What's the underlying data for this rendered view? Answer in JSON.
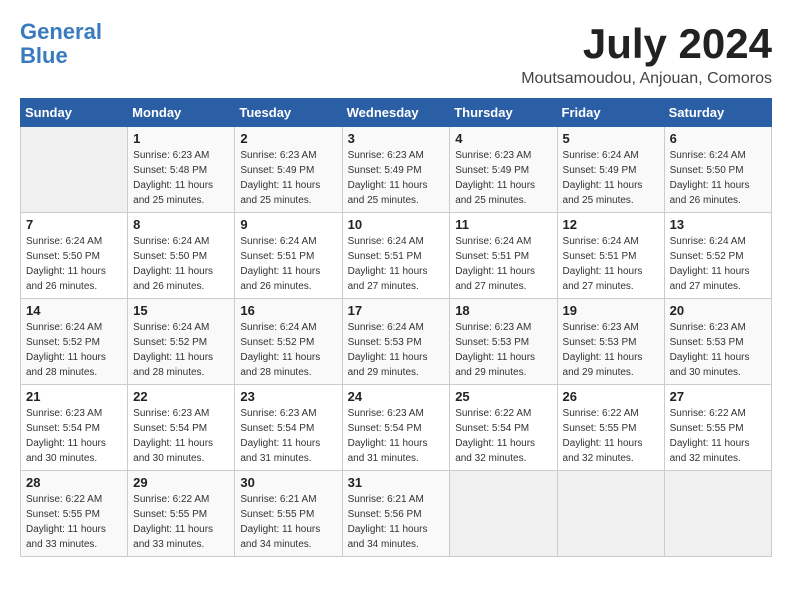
{
  "header": {
    "logo_line1": "General",
    "logo_line2": "Blue",
    "month_title": "July 2024",
    "location": "Moutsamoudou, Anjouan, Comoros"
  },
  "days_of_week": [
    "Sunday",
    "Monday",
    "Tuesday",
    "Wednesday",
    "Thursday",
    "Friday",
    "Saturday"
  ],
  "weeks": [
    [
      {
        "day": "",
        "sunrise": "",
        "sunset": "",
        "daylight": ""
      },
      {
        "day": "1",
        "sunrise": "Sunrise: 6:23 AM",
        "sunset": "Sunset: 5:48 PM",
        "daylight": "Daylight: 11 hours and 25 minutes."
      },
      {
        "day": "2",
        "sunrise": "Sunrise: 6:23 AM",
        "sunset": "Sunset: 5:49 PM",
        "daylight": "Daylight: 11 hours and 25 minutes."
      },
      {
        "day": "3",
        "sunrise": "Sunrise: 6:23 AM",
        "sunset": "Sunset: 5:49 PM",
        "daylight": "Daylight: 11 hours and 25 minutes."
      },
      {
        "day": "4",
        "sunrise": "Sunrise: 6:23 AM",
        "sunset": "Sunset: 5:49 PM",
        "daylight": "Daylight: 11 hours and 25 minutes."
      },
      {
        "day": "5",
        "sunrise": "Sunrise: 6:24 AM",
        "sunset": "Sunset: 5:49 PM",
        "daylight": "Daylight: 11 hours and 25 minutes."
      },
      {
        "day": "6",
        "sunrise": "Sunrise: 6:24 AM",
        "sunset": "Sunset: 5:50 PM",
        "daylight": "Daylight: 11 hours and 26 minutes."
      }
    ],
    [
      {
        "day": "7",
        "sunrise": "Sunrise: 6:24 AM",
        "sunset": "Sunset: 5:50 PM",
        "daylight": "Daylight: 11 hours and 26 minutes."
      },
      {
        "day": "8",
        "sunrise": "Sunrise: 6:24 AM",
        "sunset": "Sunset: 5:50 PM",
        "daylight": "Daylight: 11 hours and 26 minutes."
      },
      {
        "day": "9",
        "sunrise": "Sunrise: 6:24 AM",
        "sunset": "Sunset: 5:51 PM",
        "daylight": "Daylight: 11 hours and 26 minutes."
      },
      {
        "day": "10",
        "sunrise": "Sunrise: 6:24 AM",
        "sunset": "Sunset: 5:51 PM",
        "daylight": "Daylight: 11 hours and 27 minutes."
      },
      {
        "day": "11",
        "sunrise": "Sunrise: 6:24 AM",
        "sunset": "Sunset: 5:51 PM",
        "daylight": "Daylight: 11 hours and 27 minutes."
      },
      {
        "day": "12",
        "sunrise": "Sunrise: 6:24 AM",
        "sunset": "Sunset: 5:51 PM",
        "daylight": "Daylight: 11 hours and 27 minutes."
      },
      {
        "day": "13",
        "sunrise": "Sunrise: 6:24 AM",
        "sunset": "Sunset: 5:52 PM",
        "daylight": "Daylight: 11 hours and 27 minutes."
      }
    ],
    [
      {
        "day": "14",
        "sunrise": "Sunrise: 6:24 AM",
        "sunset": "Sunset: 5:52 PM",
        "daylight": "Daylight: 11 hours and 28 minutes."
      },
      {
        "day": "15",
        "sunrise": "Sunrise: 6:24 AM",
        "sunset": "Sunset: 5:52 PM",
        "daylight": "Daylight: 11 hours and 28 minutes."
      },
      {
        "day": "16",
        "sunrise": "Sunrise: 6:24 AM",
        "sunset": "Sunset: 5:52 PM",
        "daylight": "Daylight: 11 hours and 28 minutes."
      },
      {
        "day": "17",
        "sunrise": "Sunrise: 6:24 AM",
        "sunset": "Sunset: 5:53 PM",
        "daylight": "Daylight: 11 hours and 29 minutes."
      },
      {
        "day": "18",
        "sunrise": "Sunrise: 6:23 AM",
        "sunset": "Sunset: 5:53 PM",
        "daylight": "Daylight: 11 hours and 29 minutes."
      },
      {
        "day": "19",
        "sunrise": "Sunrise: 6:23 AM",
        "sunset": "Sunset: 5:53 PM",
        "daylight": "Daylight: 11 hours and 29 minutes."
      },
      {
        "day": "20",
        "sunrise": "Sunrise: 6:23 AM",
        "sunset": "Sunset: 5:53 PM",
        "daylight": "Daylight: 11 hours and 30 minutes."
      }
    ],
    [
      {
        "day": "21",
        "sunrise": "Sunrise: 6:23 AM",
        "sunset": "Sunset: 5:54 PM",
        "daylight": "Daylight: 11 hours and 30 minutes."
      },
      {
        "day": "22",
        "sunrise": "Sunrise: 6:23 AM",
        "sunset": "Sunset: 5:54 PM",
        "daylight": "Daylight: 11 hours and 30 minutes."
      },
      {
        "day": "23",
        "sunrise": "Sunrise: 6:23 AM",
        "sunset": "Sunset: 5:54 PM",
        "daylight": "Daylight: 11 hours and 31 minutes."
      },
      {
        "day": "24",
        "sunrise": "Sunrise: 6:23 AM",
        "sunset": "Sunset: 5:54 PM",
        "daylight": "Daylight: 11 hours and 31 minutes."
      },
      {
        "day": "25",
        "sunrise": "Sunrise: 6:22 AM",
        "sunset": "Sunset: 5:54 PM",
        "daylight": "Daylight: 11 hours and 32 minutes."
      },
      {
        "day": "26",
        "sunrise": "Sunrise: 6:22 AM",
        "sunset": "Sunset: 5:55 PM",
        "daylight": "Daylight: 11 hours and 32 minutes."
      },
      {
        "day": "27",
        "sunrise": "Sunrise: 6:22 AM",
        "sunset": "Sunset: 5:55 PM",
        "daylight": "Daylight: 11 hours and 32 minutes."
      }
    ],
    [
      {
        "day": "28",
        "sunrise": "Sunrise: 6:22 AM",
        "sunset": "Sunset: 5:55 PM",
        "daylight": "Daylight: 11 hours and 33 minutes."
      },
      {
        "day": "29",
        "sunrise": "Sunrise: 6:22 AM",
        "sunset": "Sunset: 5:55 PM",
        "daylight": "Daylight: 11 hours and 33 minutes."
      },
      {
        "day": "30",
        "sunrise": "Sunrise: 6:21 AM",
        "sunset": "Sunset: 5:55 PM",
        "daylight": "Daylight: 11 hours and 34 minutes."
      },
      {
        "day": "31",
        "sunrise": "Sunrise: 6:21 AM",
        "sunset": "Sunset: 5:56 PM",
        "daylight": "Daylight: 11 hours and 34 minutes."
      },
      {
        "day": "",
        "sunrise": "",
        "sunset": "",
        "daylight": ""
      },
      {
        "day": "",
        "sunrise": "",
        "sunset": "",
        "daylight": ""
      },
      {
        "day": "",
        "sunrise": "",
        "sunset": "",
        "daylight": ""
      }
    ]
  ]
}
